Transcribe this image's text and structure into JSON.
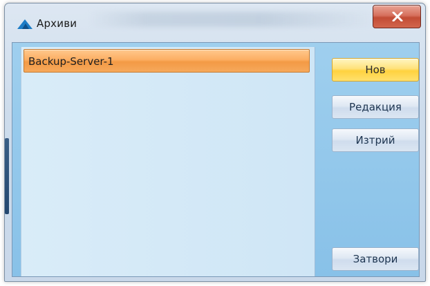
{
  "window": {
    "title": "Архиви"
  },
  "titlebar": {
    "close_icon": "close-x-icon",
    "app_icon": "archive-triangle-icon"
  },
  "list": {
    "items": [
      {
        "label": "Backup-Server-1",
        "selected": true
      }
    ]
  },
  "buttons": {
    "new_label": "Нов",
    "edit_label": "Редакция",
    "delete_label": "Изтрий",
    "close_label": "Затвори"
  },
  "colors": {
    "selected_item": "#fcae63",
    "primary_button": "#ffd23f",
    "close_button": "#c24c35",
    "panel_background": "#9fcfee"
  }
}
